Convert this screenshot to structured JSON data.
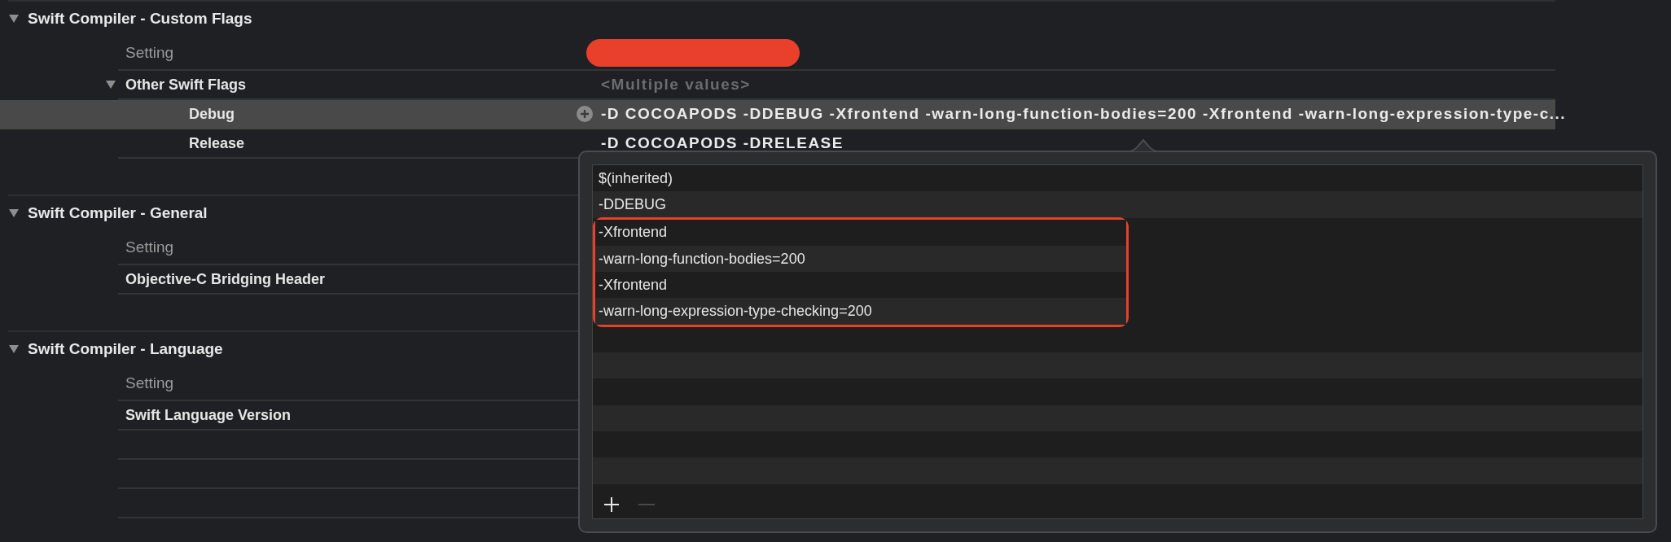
{
  "sections": [
    {
      "title": "Swift Compiler - Custom Flags",
      "expanded": true,
      "column_label": "Setting",
      "value_redacted": true,
      "rows": [
        {
          "kind": "group",
          "name": "Other Swift Flags",
          "value": "<Multiple values>",
          "expanded": true,
          "selected": false,
          "children": [
            {
              "kind": "setting",
              "name": "Debug",
              "value": "-D COCOAPODS -DDEBUG -Xfrontend -warn-long-function-bodies=200 -Xfrontend -warn-long-expression-type-c...",
              "selected": true
            },
            {
              "kind": "setting",
              "name": "Release",
              "value": "-D COCOAPODS -DRELEASE",
              "selected": false
            }
          ]
        }
      ]
    },
    {
      "title": "Swift Compiler - General",
      "expanded": true,
      "column_label": "Setting",
      "rows": [
        {
          "kind": "setting",
          "name": "Objective-C Bridging Header",
          "selected": false
        }
      ]
    },
    {
      "title": "Swift Compiler - Language",
      "expanded": true,
      "column_label": "Setting",
      "rows": [
        {
          "kind": "setting",
          "name": "Swift Language Version",
          "selected": false
        }
      ]
    }
  ],
  "popup": {
    "items": [
      {
        "text": "$(inherited)",
        "outlined": false
      },
      {
        "text": "-DDEBUG",
        "outlined": false
      },
      {
        "text": "-Xfrontend",
        "outlined": true
      },
      {
        "text": "-warn-long-function-bodies=200",
        "outlined": true
      },
      {
        "text": "-Xfrontend",
        "outlined": true
      },
      {
        "text": "-warn-long-expression-type-checking=200",
        "outlined": true
      }
    ],
    "buttons": [
      {
        "kind": "add",
        "disabled": false
      },
      {
        "kind": "remove",
        "disabled": true
      }
    ]
  }
}
